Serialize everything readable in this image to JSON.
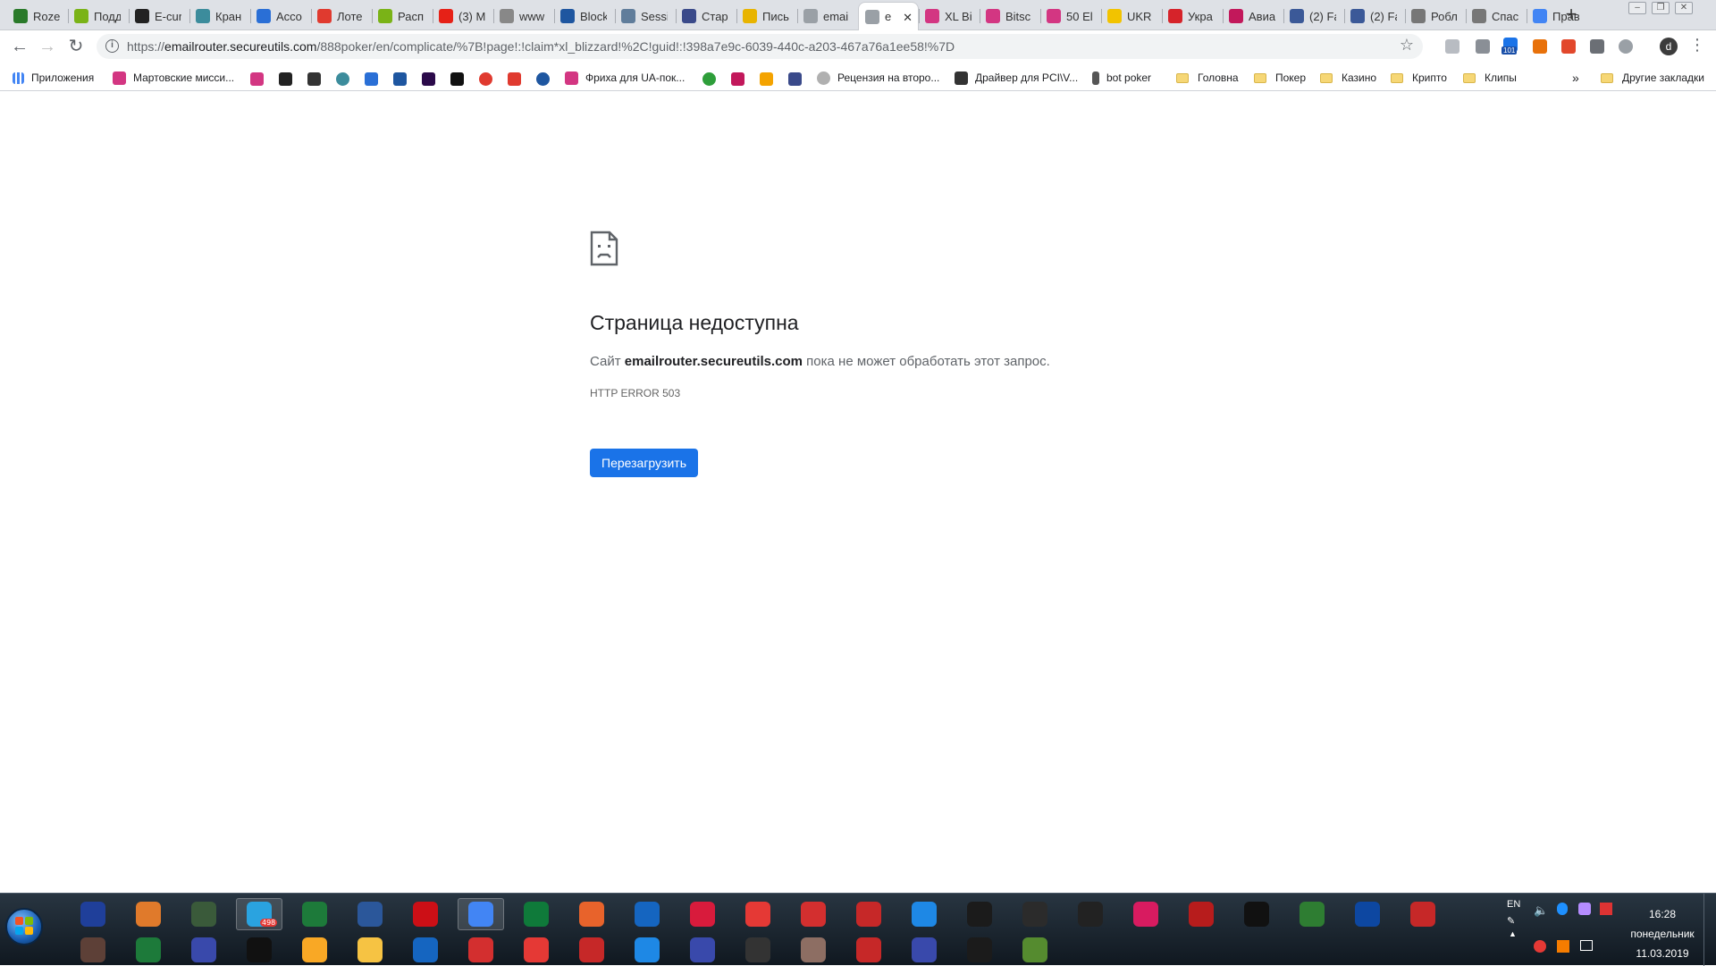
{
  "browser": {
    "tabs": [
      {
        "title": "Roze",
        "color": "#2a7a2a"
      },
      {
        "title": "Подд",
        "color": "#7ab317"
      },
      {
        "title": "E-cur",
        "color": "#222222"
      },
      {
        "title": "Кран",
        "color": "#3c8c9c"
      },
      {
        "title": "Acco",
        "color": "#2a6fd6"
      },
      {
        "title": "Лоте",
        "color": "#e03a2f"
      },
      {
        "title": "Расп",
        "color": "#7ab317"
      },
      {
        "title": "(3) M",
        "color": "#e62117"
      },
      {
        "title": "www",
        "color": "#888888"
      },
      {
        "title": "Block",
        "color": "#1e56a0"
      },
      {
        "title": "Sessi",
        "color": "#607d9b"
      },
      {
        "title": "Стар",
        "color": "#3a4a8a"
      },
      {
        "title": "Пись",
        "color": "#e8b400"
      },
      {
        "title": "emai",
        "color": "#9aa0a6"
      },
      {
        "title": "e",
        "color": "#9aa0a6",
        "active": true
      },
      {
        "title": "XL Bi",
        "color": "#d33682"
      },
      {
        "title": "Bitsc",
        "color": "#d33682"
      },
      {
        "title": "50 El",
        "color": "#d33682"
      },
      {
        "title": "UKR",
        "color": "#f2c300"
      },
      {
        "title": "Укра",
        "color": "#d6232a"
      },
      {
        "title": "Авиа",
        "color": "#c2185b"
      },
      {
        "title": "(2) Fa",
        "color": "#3b5998"
      },
      {
        "title": "(2) Fa",
        "color": "#3b5998"
      },
      {
        "title": "Робл",
        "color": "#777777"
      },
      {
        "title": "Спас",
        "color": "#777777"
      },
      {
        "title": "Прав",
        "color": "#4285f4"
      }
    ],
    "new_tab": "+",
    "tab_close": "✕",
    "url": {
      "scheme": "https://",
      "host": "emailrouter.secureutils.com",
      "path": "/888poker/en/complicate/%7B!page!:!claim*xl_blizzard!%2C!guid!:!398a7e9c-6039-440c-a203-467a76a1ee58!%7D"
    },
    "extension_badge": "101",
    "profile_initial": "d",
    "bookmarks": [
      {
        "label": "Приложения",
        "kind": "apps"
      },
      {
        "label": "Мартовские мисси...",
        "kind": "site",
        "color": "#d33682"
      },
      {
        "label": "Фриха для UA-пок...",
        "kind": "site",
        "color": "#d33682"
      },
      {
        "label": "Рецензия на второ...",
        "kind": "site",
        "color": "#b0b0b0"
      },
      {
        "label": "Драйвер для PCI\\V...",
        "kind": "site",
        "color": "#333333"
      },
      {
        "label": "bot poker",
        "kind": "site",
        "color": "#555555"
      },
      {
        "label": "Головна",
        "kind": "folder"
      },
      {
        "label": "Покер",
        "kind": "folder"
      },
      {
        "label": "Казино",
        "kind": "folder"
      },
      {
        "label": "Крипто",
        "kind": "folder"
      },
      {
        "label": "Клипы",
        "kind": "folder"
      },
      {
        "label": "»",
        "kind": "overflow"
      },
      {
        "label": "Другие закладки",
        "kind": "folder"
      }
    ]
  },
  "error_page": {
    "title": "Страница недоступна",
    "desc_before": "Сайт ",
    "desc_host": "emailrouter.secureutils.com",
    "desc_after": " пока не может обработать этот запрос.",
    "code": "HTTP ERROR 503",
    "reload_label": "Перезагрузить"
  },
  "taskbar": {
    "language": "EN",
    "time": "16:28",
    "day": "понедельник",
    "date": "11.03.2019",
    "telegram_badge": "498"
  }
}
